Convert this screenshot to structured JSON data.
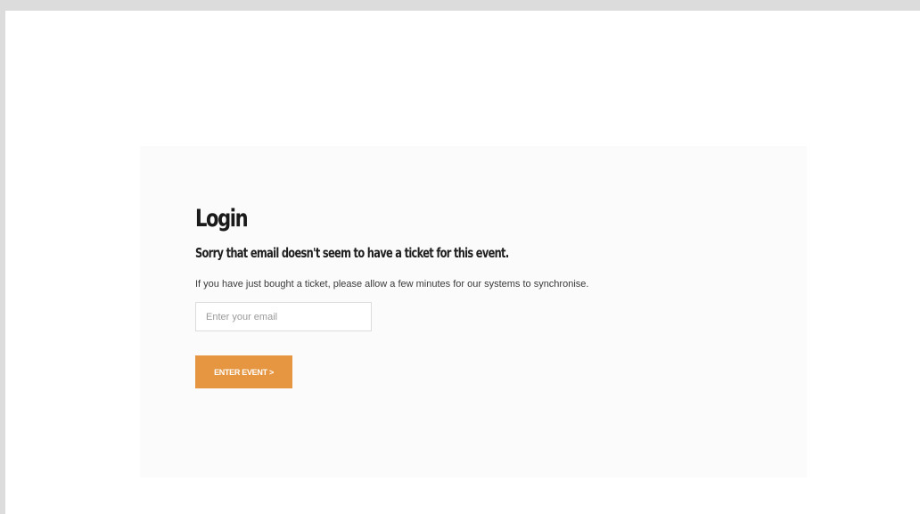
{
  "login": {
    "title": "Login",
    "error_message": "Sorry that email doesn't seem to have a ticket for this event.",
    "info_message": "If you have just bought a ticket, please allow a few minutes for our systems to synchronise.",
    "email_placeholder": "Enter your email",
    "email_value": "",
    "submit_label": "ENTER EVENT >"
  },
  "colors": {
    "page_frame": "#dcdcdc",
    "page_background": "#ffffff",
    "panel_background": "#fbfbfb",
    "accent": "#e69540",
    "text": "#1a1a1a"
  }
}
